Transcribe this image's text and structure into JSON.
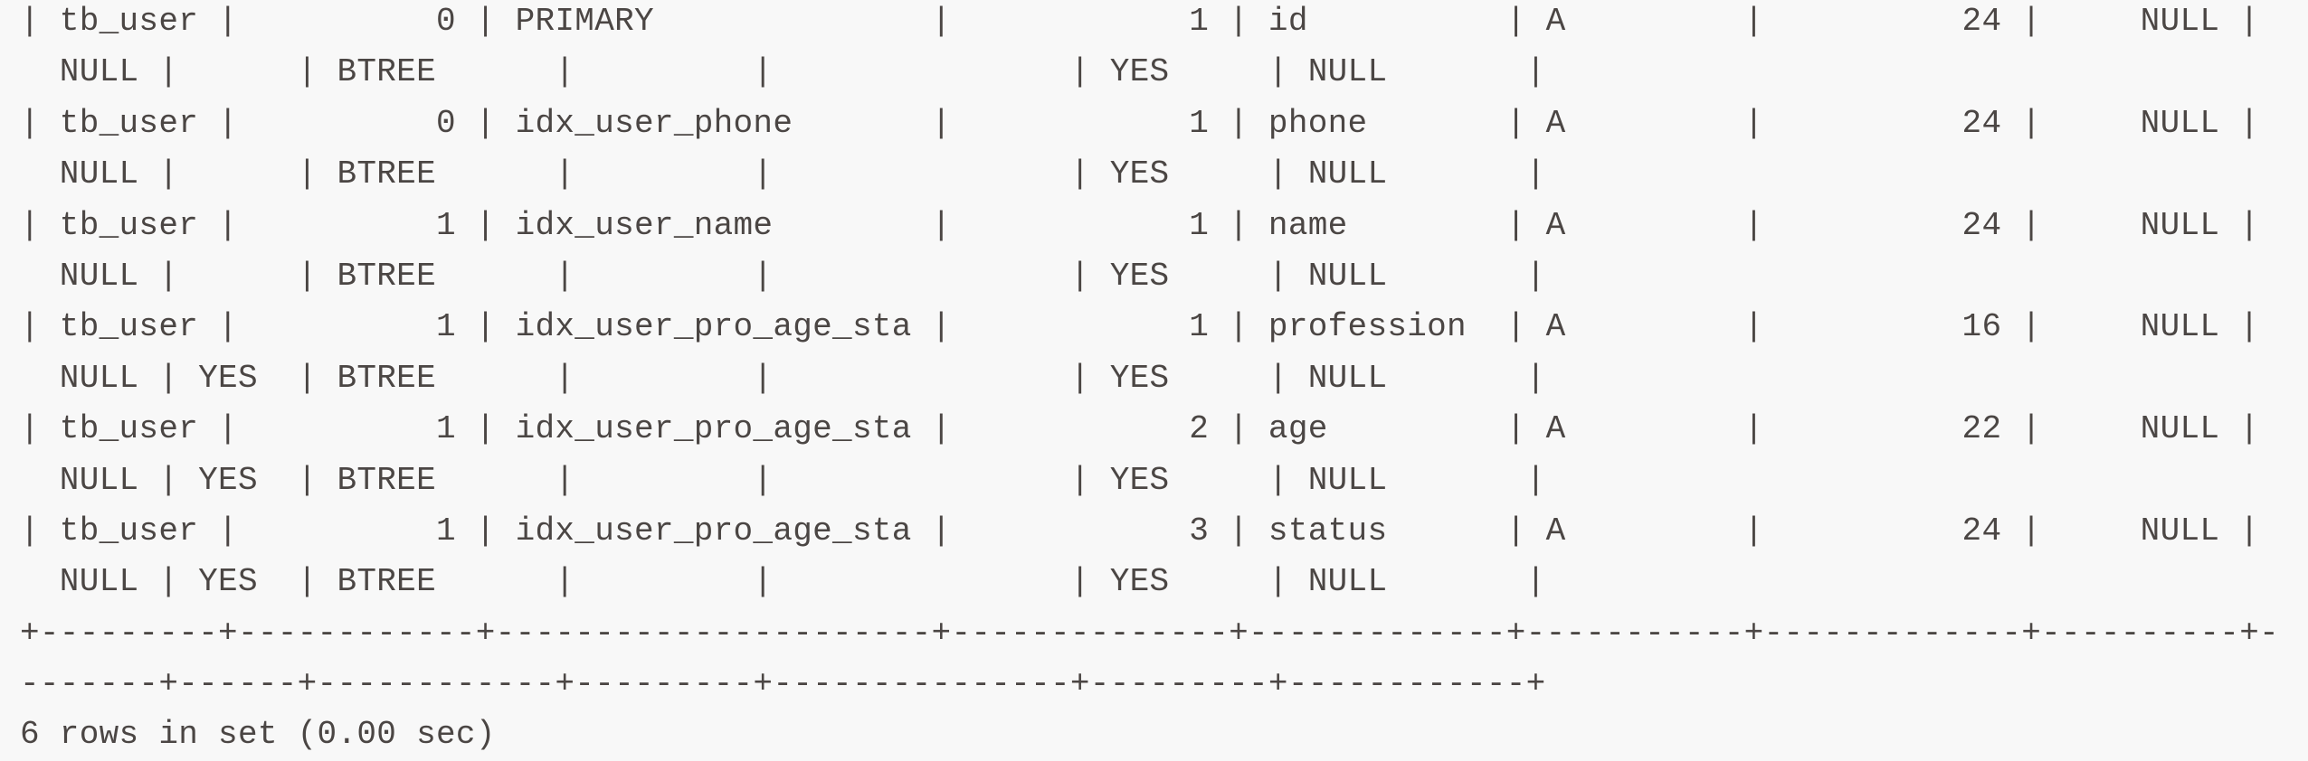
{
  "lines": [
    "| tb_user |          0 | PRIMARY              |            1 | id          | A         |          24 |     NULL | ",
    "  NULL |      | BTREE      |         |               | YES     | NULL       |",
    "| tb_user |          0 | idx_user_phone       |            1 | phone       | A         |          24 |     NULL | ",
    "  NULL |      | BTREE      |         |               | YES     | NULL       |",
    "| tb_user |          1 | idx_user_name        |            1 | name        | A         |          24 |     NULL | ",
    "  NULL |      | BTREE      |         |               | YES     | NULL       |",
    "| tb_user |          1 | idx_user_pro_age_sta |            1 | profession  | A         |          16 |     NULL | ",
    "  NULL | YES  | BTREE      |         |               | YES     | NULL       |",
    "| tb_user |          1 | idx_user_pro_age_sta |            2 | age         | A         |          22 |     NULL | ",
    "  NULL | YES  | BTREE      |         |               | YES     | NULL       |",
    "| tb_user |          1 | idx_user_pro_age_sta |            3 | status      | A         |          24 |     NULL | ",
    "  NULL | YES  | BTREE      |         |               | YES     | NULL       |",
    "+---------+------------+----------------------+--------------+-------------+-----------+-------------+----------+-",
    "-------+------+------------+---------+---------------+---------+------------+",
    "6 rows in set (0.00 sec)"
  ],
  "colors": {
    "background": "#f8f8f8",
    "text": "#4b4644"
  }
}
